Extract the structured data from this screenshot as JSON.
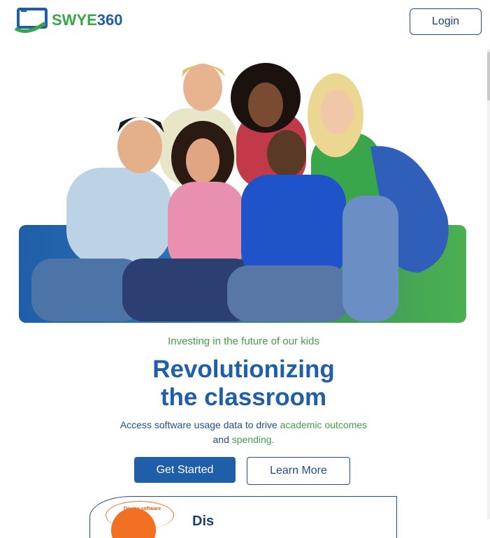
{
  "header": {
    "brand_part1": "SWYE",
    "brand_part2": "360",
    "login_label": "Login"
  },
  "hero": {
    "image_alt": "Group of smiling students"
  },
  "content": {
    "tagline": "Investing in the future of our kids",
    "headline_line1": "Revolutionizing",
    "headline_line2": "the classroom",
    "sub_part1": "Access software usage data to drive ",
    "sub_highlight1": "academic outcomes",
    "sub_part2": "and ",
    "sub_highlight2": "spending."
  },
  "actions": {
    "primary_label": "Get Started",
    "secondary_label": "Learn More"
  },
  "bottom_card": {
    "badge_text": "Device software",
    "title_partial": "Dis"
  },
  "colors": {
    "brand_blue": "#1f5ea8",
    "brand_green": "#43a047",
    "accent_orange": "#f36f21"
  }
}
